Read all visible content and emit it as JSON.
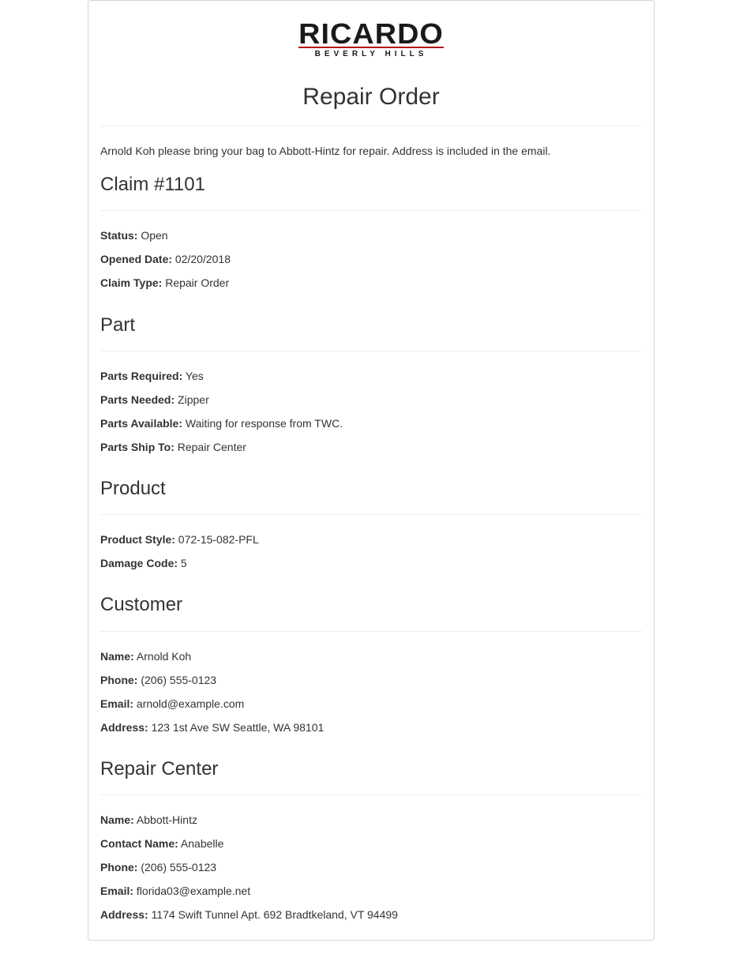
{
  "brand": {
    "name": "RICARDO",
    "tagline": "BEVERLY HILLS",
    "accent_color": "#b5121b"
  },
  "title": "Repair Order",
  "intro": "Arnold Koh please bring your bag to Abbott-Hintz for repair. Address is included in the email.",
  "claim": {
    "heading": "Claim #1101",
    "fields": [
      {
        "label": "Status:",
        "value": "Open"
      },
      {
        "label": "Opened Date:",
        "value": "02/20/2018"
      },
      {
        "label": "Claim Type:",
        "value": "Repair Order"
      }
    ]
  },
  "part": {
    "heading": "Part",
    "fields": [
      {
        "label": "Parts Required:",
        "value": "Yes"
      },
      {
        "label": "Parts Needed:",
        "value": "Zipper"
      },
      {
        "label": "Parts Available:",
        "value": "Waiting for response from TWC."
      },
      {
        "label": "Parts Ship To:",
        "value": "Repair Center"
      }
    ]
  },
  "product": {
    "heading": "Product",
    "fields": [
      {
        "label": "Product Style:",
        "value": "072-15-082-PFL"
      },
      {
        "label": "Damage Code:",
        "value": "5"
      }
    ]
  },
  "customer": {
    "heading": "Customer",
    "fields": [
      {
        "label": "Name:",
        "value": "Arnold Koh"
      },
      {
        "label": "Phone:",
        "value": "(206) 555-0123"
      },
      {
        "label": "Email:",
        "value": "arnold@example.com"
      },
      {
        "label": "Address:",
        "value": "123 1st Ave SW Seattle, WA 98101"
      }
    ]
  },
  "repair_center": {
    "heading": "Repair Center",
    "fields": [
      {
        "label": "Name:",
        "value": "Abbott-Hintz"
      },
      {
        "label": "Contact Name:",
        "value": "Anabelle"
      },
      {
        "label": "Phone:",
        "value": "(206) 555-0123"
      },
      {
        "label": "Email:",
        "value": "florida03@example.net"
      },
      {
        "label": "Address:",
        "value": "1174 Swift Tunnel Apt. 692 Bradtkeland, VT 94499"
      }
    ]
  }
}
